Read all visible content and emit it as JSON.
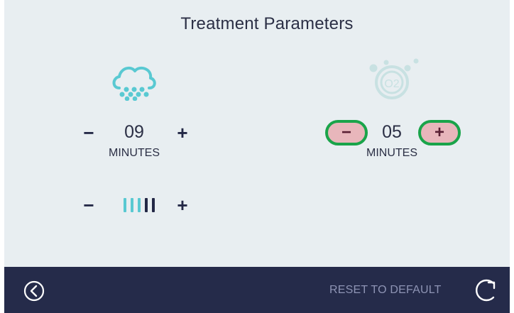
{
  "header": {
    "title": "Treatment Parameters"
  },
  "left_panel": {
    "icon": "cloud-mist-icon",
    "time_minus": "−",
    "time_value": "09",
    "time_plus": "+",
    "time_unit": "MINUTES",
    "intensity_minus": "−",
    "intensity_plus": "+",
    "intensity_level": 3,
    "intensity_max": 5,
    "intensity_icon": "intensity-bars-icon"
  },
  "right_panel": {
    "icon": "oxygen-o2-icon",
    "o2_label": "O2",
    "time_minus": "−",
    "time_value": "05",
    "time_plus": "+",
    "time_unit": "MINUTES"
  },
  "footer": {
    "back_icon": "back-icon",
    "reset_label": "RESET TO DEFAULT",
    "refresh_icon": "refresh-icon"
  },
  "colors": {
    "background": "#e8eef1",
    "footer": "#252b4a",
    "accent_teal": "#59c9d2",
    "highlight_green": "#1aa44a",
    "highlight_pink": "#e8b6bb"
  }
}
